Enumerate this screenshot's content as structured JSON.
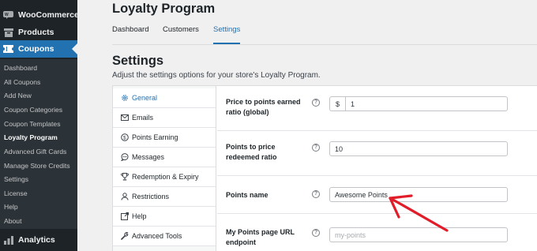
{
  "sidebar": {
    "woocommerce_label": "WooCommerce",
    "products_label": "Products",
    "coupons_label": "Coupons",
    "submenu": [
      {
        "label": "Dashboard",
        "current": false
      },
      {
        "label": "All Coupons",
        "current": false
      },
      {
        "label": "Add New",
        "current": false
      },
      {
        "label": "Coupon Categories",
        "current": false
      },
      {
        "label": "Coupon Templates",
        "current": false
      },
      {
        "label": "Loyalty Program",
        "current": true
      },
      {
        "label": "Advanced Gift Cards",
        "current": false
      },
      {
        "label": "Manage Store Credits",
        "current": false
      },
      {
        "label": "Settings",
        "current": false
      },
      {
        "label": "License",
        "current": false
      },
      {
        "label": "Help",
        "current": false
      },
      {
        "label": "About",
        "current": false
      }
    ],
    "analytics_label": "Analytics"
  },
  "header": {
    "title": "Loyalty Program",
    "tabs": [
      {
        "label": "Dashboard",
        "active": false
      },
      {
        "label": "Customers",
        "active": false
      },
      {
        "label": "Settings",
        "active": true
      }
    ]
  },
  "settings": {
    "heading": "Settings",
    "description": "Adjust the settings options for your store's Loyalty Program.",
    "nav": [
      {
        "label": "General",
        "icon": "gear-icon",
        "active": true
      },
      {
        "label": "Emails",
        "icon": "envelope-icon",
        "active": false
      },
      {
        "label": "Points Earning",
        "icon": "dollar-circle-icon",
        "active": false
      },
      {
        "label": "Messages",
        "icon": "speech-bubble-icon",
        "active": false
      },
      {
        "label": "Redemption & Expiry",
        "icon": "trophy-icon",
        "active": false
      },
      {
        "label": "Restrictions",
        "icon": "user-icon",
        "active": false
      },
      {
        "label": "Help",
        "icon": "external-link-icon",
        "active": false
      },
      {
        "label": "Advanced Tools",
        "icon": "wrench-icon",
        "active": false
      }
    ],
    "fields": {
      "price_to_points": {
        "label": "Price to points earned ratio (global)",
        "prefix": "$",
        "value": "1"
      },
      "points_to_price": {
        "label": "Points to price redeemed ratio",
        "value": "10"
      },
      "points_name": {
        "label": "Points name",
        "value": "Awesome Points"
      },
      "my_points_url": {
        "label": "My Points page URL endpoint",
        "placeholder": "my-points"
      }
    },
    "help_glyph": "?"
  },
  "colors": {
    "accent": "#2271b1",
    "sidebar_bg": "#1d2327",
    "submenu_bg": "#2c3338",
    "annotation_arrow": "#e11d2a"
  }
}
